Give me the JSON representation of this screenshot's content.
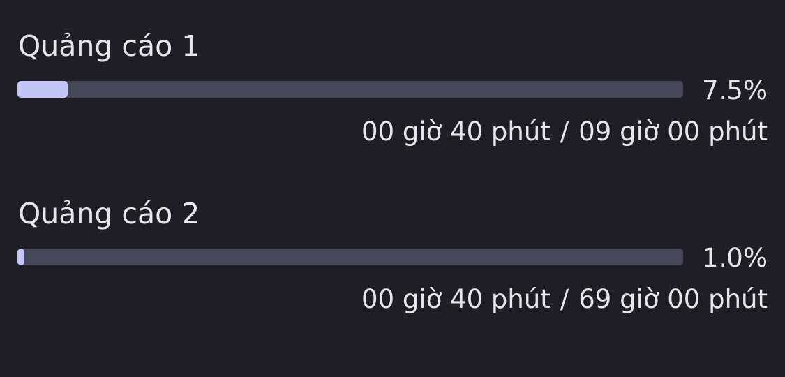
{
  "ads": [
    {
      "title": "Quảng cáo 1",
      "progress_percent": 7.5,
      "percent_label": "7.5%",
      "elapsed": "00 giờ 40 phút",
      "separator": "/",
      "total": "09 giờ 00 phút"
    },
    {
      "title": "Quảng cáo 2",
      "progress_percent": 1.0,
      "percent_label": "1.0%",
      "elapsed": "00 giờ 40 phút",
      "separator": "/",
      "total": "69 giờ 00 phút"
    }
  ],
  "colors": {
    "background": "#1f1e24",
    "track": "#454859",
    "fill": "#c3c4f8",
    "text": "#e6e6ec"
  }
}
